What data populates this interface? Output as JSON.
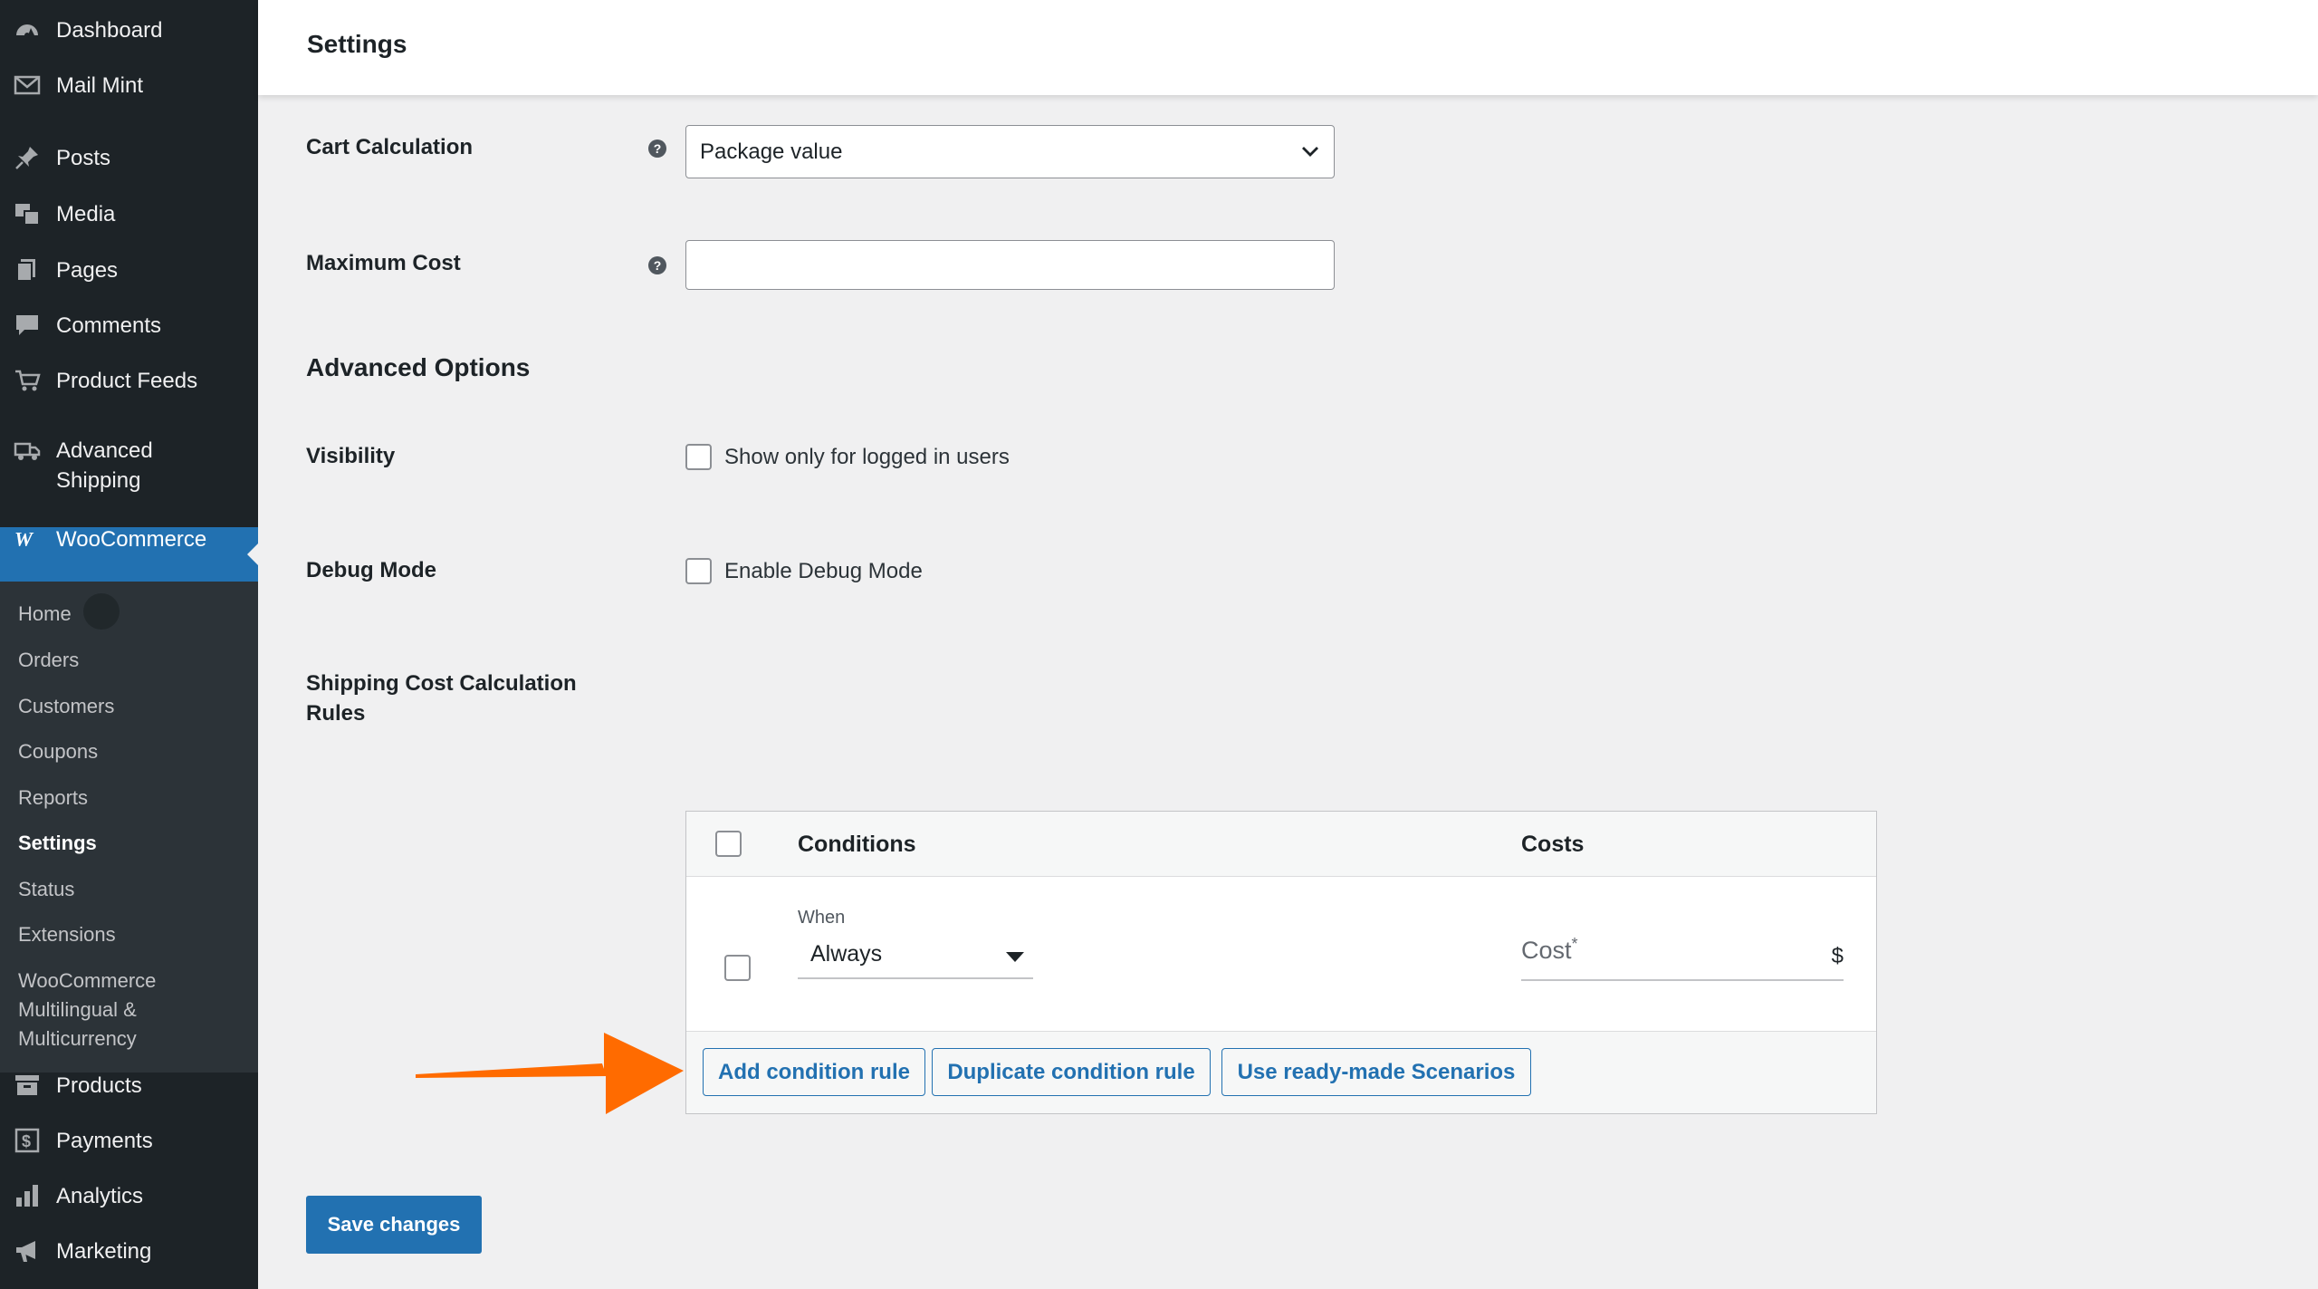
{
  "page": {
    "title": "Settings"
  },
  "sidebar": {
    "items": [
      {
        "label": "Dashboard",
        "icon": "dashboard-icon"
      },
      {
        "label": "Mail Mint",
        "icon": "mail-icon"
      },
      {
        "label": "Posts",
        "icon": "pin-icon"
      },
      {
        "label": "Media",
        "icon": "media-icon"
      },
      {
        "label": "Pages",
        "icon": "pages-icon"
      },
      {
        "label": "Comments",
        "icon": "comment-icon"
      },
      {
        "label": "Product Feeds",
        "icon": "cart-icon"
      },
      {
        "label": "Advanced",
        "label2": "Shipping",
        "icon": "shipping-icon"
      },
      {
        "label": "WooCommerce",
        "icon": "woocommerce-icon"
      },
      {
        "label": "Products",
        "icon": "products-icon"
      },
      {
        "label": "Payments",
        "icon": "payments-icon"
      },
      {
        "label": "Analytics",
        "icon": "analytics-icon"
      },
      {
        "label": "Marketing",
        "icon": "megaphone-icon"
      }
    ],
    "submenu": [
      "Home",
      "Orders",
      "Customers",
      "Coupons",
      "Reports",
      "Settings",
      "Status",
      "Extensions",
      "WooCommerce",
      "Multilingual &",
      "Multicurrency"
    ],
    "current_submenu": "Settings"
  },
  "form": {
    "cart_calculation": {
      "label": "Cart Calculation",
      "value": "Package value"
    },
    "maximum_cost": {
      "label": "Maximum Cost",
      "value": ""
    },
    "advanced_options_title": "Advanced Options",
    "visibility": {
      "label": "Visibility",
      "checkbox_label": "Show only for logged in users",
      "checked": false
    },
    "debug_mode": {
      "label": "Debug Mode",
      "checkbox_label": "Enable Debug Mode",
      "checked": false
    },
    "rules_label_line1": "Shipping Cost Calculation",
    "rules_label_line2": "Rules"
  },
  "rules_table": {
    "headers": {
      "conditions": "Conditions",
      "costs": "Costs"
    },
    "row": {
      "when_label": "When",
      "condition_value": "Always",
      "cost_placeholder": "Cost",
      "required_mark": "*",
      "currency": "$"
    },
    "buttons": {
      "add": "Add condition rule",
      "duplicate": "Duplicate condition rule",
      "scenarios": "Use ready-made Scenarios"
    }
  },
  "actions": {
    "save": "Save changes"
  },
  "colors": {
    "sidebar_bg": "#1d2327",
    "accent": "#2271b1",
    "arrow": "#ff6b00"
  }
}
